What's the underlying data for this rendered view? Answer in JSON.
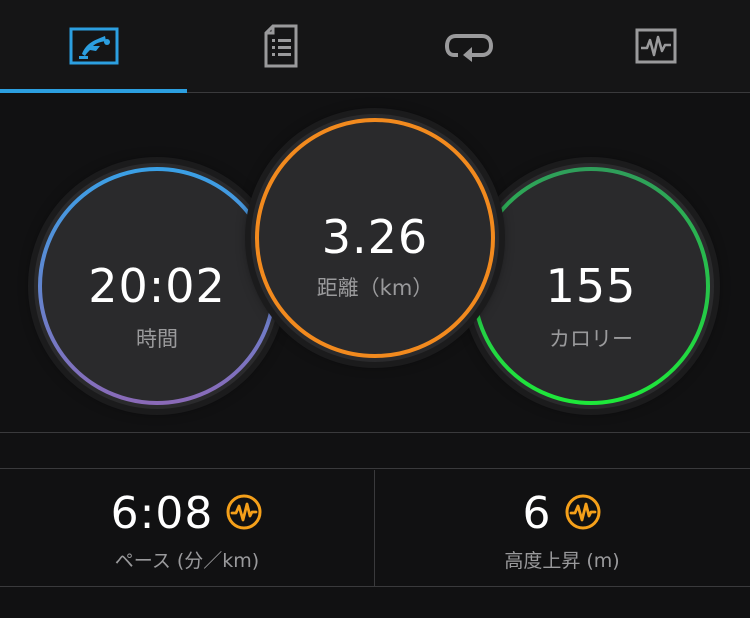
{
  "tabs": [
    {
      "name": "overview",
      "icon": "running-activity-icon",
      "active": true
    },
    {
      "name": "details",
      "icon": "document-list-icon",
      "active": false
    },
    {
      "name": "laps",
      "icon": "loop-arrow-icon",
      "active": false
    },
    {
      "name": "charts",
      "icon": "heartrate-graph-icon",
      "active": false
    }
  ],
  "rings": {
    "time": {
      "value": "20:02",
      "label": "時間"
    },
    "distance": {
      "value": "3.26",
      "label": "距離（km）"
    },
    "calories": {
      "value": "155",
      "label": "カロリー"
    }
  },
  "stats": {
    "pace": {
      "value": "6:08",
      "label": "ペース (分／km)"
    },
    "elevation": {
      "value": "6",
      "label": "高度上昇 (m)"
    }
  },
  "colors": {
    "accent": "#2c9fe0",
    "orange": "#f28a1e",
    "green": "#1ee83a",
    "blue": "#3aa0e6",
    "purple": "#8a6ab8",
    "badge": "#f5a01a"
  }
}
